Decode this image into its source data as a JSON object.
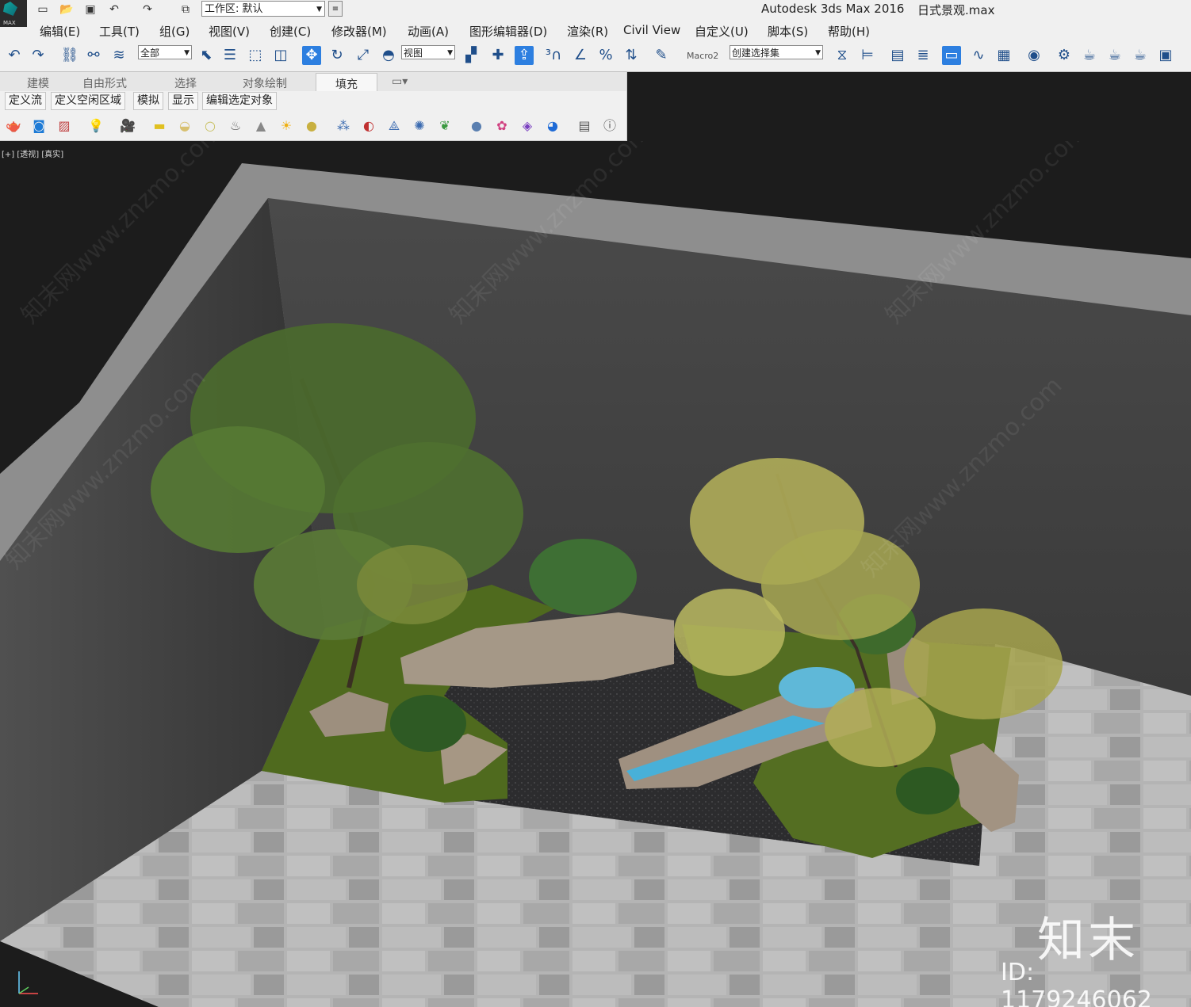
{
  "titlebar": {
    "logo_text": "MAX",
    "workspace_label": "工作区: 默认",
    "app_title": "Autodesk 3ds Max 2016",
    "file_name": "日式景观.max"
  },
  "menu": [
    {
      "label": "编辑(E)"
    },
    {
      "label": "工具(T)"
    },
    {
      "label": "组(G)"
    },
    {
      "label": "视图(V)"
    },
    {
      "label": "创建(C)"
    },
    {
      "label": "修改器(M)"
    },
    {
      "label": "动画(A)"
    },
    {
      "label": "图形编辑器(D)"
    },
    {
      "label": "渲染(R)"
    },
    {
      "label": "Civil View"
    },
    {
      "label": "自定义(U)"
    },
    {
      "label": "脚本(S)"
    },
    {
      "label": "帮助(H)"
    }
  ],
  "toolbar": {
    "selection_filter": "全部",
    "reference_coord": "视图",
    "macro_label": "Macro2",
    "named_selection": "创建选择集"
  },
  "ribbon_tabs": [
    "建模",
    "自由形式",
    "选择",
    "对象绘制",
    "填充"
  ],
  "ribbon_active": "填充",
  "sub_tabs": [
    "定义流",
    "定义空闲区域",
    "模拟",
    "显示",
    "编辑选定对象"
  ],
  "viewport": {
    "label": "[+] [透视] [真实]"
  },
  "watermarks": {
    "brand": "知末",
    "id": "ID: 1179246062",
    "diagonal": "知末网www.znzmo.com"
  },
  "icons": {
    "undo": "undo-icon",
    "redo": "redo-icon",
    "link": "link-icon",
    "select": "select-icon",
    "move": "move-icon",
    "rotate": "rotate-icon",
    "scale": "scale-icon"
  }
}
